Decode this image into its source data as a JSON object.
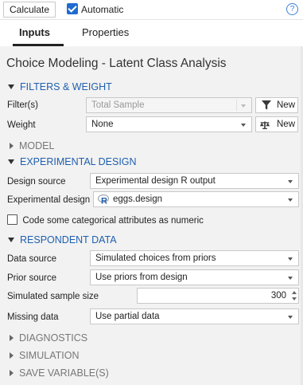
{
  "toolbar": {
    "calculate_label": "Calculate",
    "automatic_label": "Automatic",
    "automatic_checked": true,
    "help_glyph": "?"
  },
  "tabs": [
    {
      "label": "Inputs",
      "active": true
    },
    {
      "label": "Properties",
      "active": false
    }
  ],
  "title": "Choice Modeling - Latent Class Analysis",
  "sections": {
    "filters": {
      "label": "FILTERS & WEIGHT",
      "expanded": true
    },
    "model": {
      "label": "MODEL",
      "expanded": false
    },
    "design": {
      "label": "EXPERIMENTAL DESIGN",
      "expanded": true
    },
    "respondent": {
      "label": "RESPONDENT DATA",
      "expanded": true
    },
    "diagnostics": {
      "label": "DIAGNOSTICS",
      "expanded": false
    },
    "simulation": {
      "label": "SIMULATION",
      "expanded": false
    },
    "save": {
      "label": "SAVE VARIABLE(S)",
      "expanded": false
    }
  },
  "fields": {
    "filters": {
      "label": "Filter(s)",
      "value": "Total Sample",
      "disabled": true,
      "new_label": "New",
      "icon": "funnel-icon"
    },
    "weight": {
      "label": "Weight",
      "value": "None",
      "new_label": "New",
      "icon": "scale-icon"
    },
    "design_source": {
      "label": "Design source",
      "value": "Experimental design R output"
    },
    "experimental_design": {
      "label": "Experimental design",
      "value": "eggs.design",
      "icon": "r-object-icon"
    },
    "code_numeric": {
      "label": "Code some categorical attributes as numeric",
      "checked": false
    },
    "data_source": {
      "label": "Data source",
      "value": "Simulated choices from priors"
    },
    "prior_source": {
      "label": "Prior source",
      "value": "Use priors from design"
    },
    "sample_size": {
      "label": "Simulated sample size",
      "value": "300"
    },
    "missing_data": {
      "label": "Missing data",
      "value": "Use partial data"
    }
  },
  "colors": {
    "section_blue": "#1f5fb0",
    "accent": "#1f6ccf",
    "collapsed_gray": "#777777"
  }
}
